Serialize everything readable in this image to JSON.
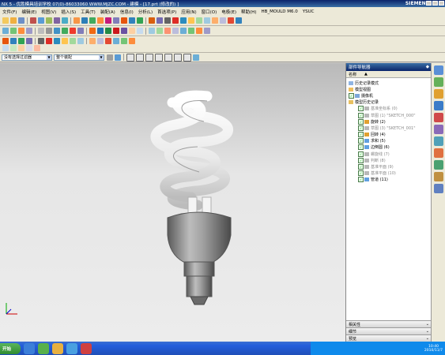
{
  "window": {
    "title": "NX 5 - 优胜模具培训学校  07(0)-86033060  WWW.MJZC.COM - 建模 - [17.prt (修改的) ]",
    "brand": "SIEMENS"
  },
  "menubar": {
    "items": [
      "文件(F)",
      "编辑(E)",
      "视图(V)",
      "插入(S)",
      "工具(T)",
      "装配(A)",
      "信息(I)",
      "分析(L)",
      "首选项(P)",
      "应用(N)",
      "窗口(O)",
      "电极(E)",
      "帮助(H)",
      "HB_MOULD M6.0",
      "YSUC"
    ]
  },
  "filterbar": {
    "type_filter": "没有选择过滤器",
    "scope_filter": "整个装配"
  },
  "nav": {
    "title": "部件导航器",
    "column_name": "名称",
    "items": [
      {
        "label": "历史记录模式",
        "dim": false,
        "icon": "clock-icon"
      },
      {
        "label": "模型视图",
        "dim": false,
        "icon": "views-icon"
      },
      {
        "label": "摄像机",
        "dim": false,
        "icon": "camera-icon"
      },
      {
        "label": "模型历史记录",
        "dim": false,
        "icon": "folder-icon"
      },
      {
        "label": "基准坐标系 (0)",
        "dim": true,
        "icon": "csys-icon"
      },
      {
        "label": "草图 (1) \"SKETCH_000\"",
        "dim": true,
        "icon": "sketch-icon"
      },
      {
        "label": "旋转 (2)",
        "dim": false,
        "icon": "revolve-icon"
      },
      {
        "label": "草图 (3) \"SKETCH_001\"",
        "dim": true,
        "icon": "sketch-icon"
      },
      {
        "label": "回转 (4)",
        "dim": false,
        "icon": "revolve-icon"
      },
      {
        "label": "求和 (5)",
        "dim": false,
        "icon": "unite-icon"
      },
      {
        "label": "边倒圆 (6)",
        "dim": false,
        "icon": "blend-icon"
      },
      {
        "label": "螺旋线 (7)",
        "dim": true,
        "icon": "helix-icon"
      },
      {
        "label": "判断 (8)",
        "dim": true,
        "icon": "datum-icon"
      },
      {
        "label": "基准平面 (9)",
        "dim": true,
        "icon": "plane-icon"
      },
      {
        "label": "基准平面 (10)",
        "dim": true,
        "icon": "plane-icon"
      },
      {
        "label": "管道 (11)",
        "dim": false,
        "icon": "tube-icon"
      }
    ],
    "panels": [
      "相关性",
      "细节",
      "预览"
    ]
  },
  "taskbar": {
    "start_label": "开始",
    "time": "10:40",
    "date": "2010/11/7"
  },
  "colors": {
    "titlebar": "#0a246a",
    "accent": "#3a6ea5",
    "viewport_top": "#b9b9b9",
    "model_gray": "#9c9c9c",
    "bulb_white": "#f2f2f2"
  }
}
